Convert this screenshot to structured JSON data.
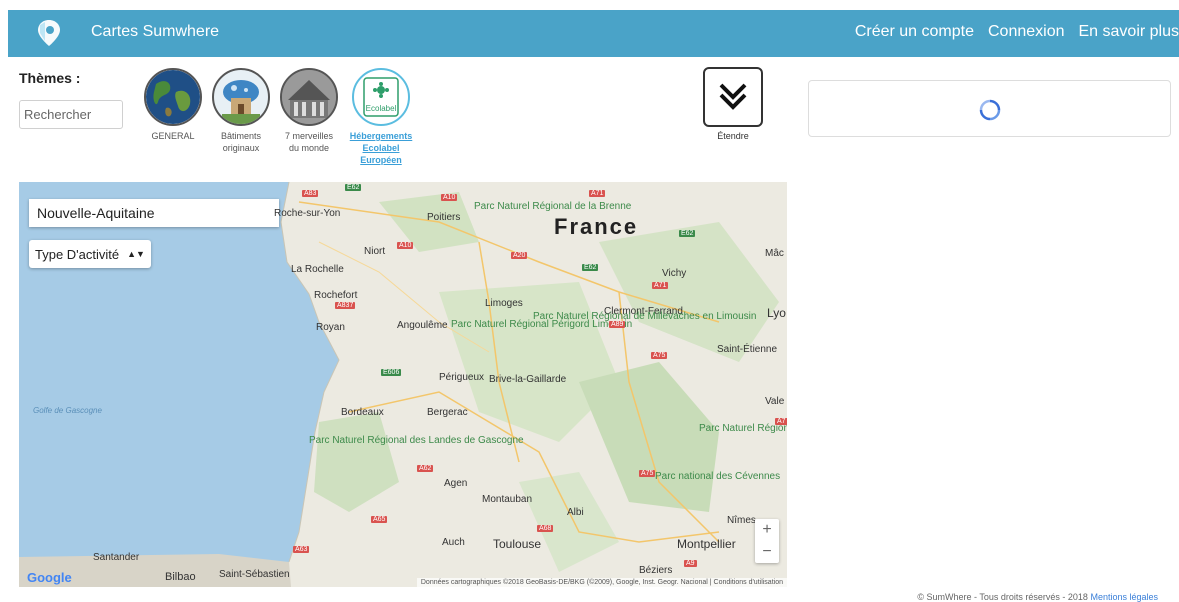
{
  "header": {
    "brand": "Cartes Sumwhere",
    "nav": [
      "Créer un compte",
      "Connexion",
      "En savoir plus"
    ]
  },
  "themes": {
    "label": "Thèmes :",
    "search_placeholder": "Rechercher",
    "items": [
      {
        "line1": "GENERAL",
        "line2": "",
        "line3": ""
      },
      {
        "line1": "Bâtiments",
        "line2": "originaux",
        "line3": ""
      },
      {
        "line1": "7 merveilles",
        "line2": "du monde",
        "line3": ""
      },
      {
        "line1": "Hébergements",
        "line2": "Ecolabel",
        "line3": "Européen"
      }
    ],
    "ecolabel_text": "Ecolabel"
  },
  "extend": {
    "label": "Étendre"
  },
  "map": {
    "region": "Nouvelle-Aquitaine",
    "activity": "Type D'activité",
    "country": "France",
    "cities": [
      "Poitiers",
      "Niort",
      "La Rochelle",
      "Rochefort",
      "Royan",
      "Angoulême",
      "Limoges",
      "Clermont-Ferrand",
      "Vichy",
      "Lyo",
      "Saint-Étienne",
      "Périgueux",
      "Brive-la-Gaillarde",
      "Bordeaux",
      "Bergerac",
      "Agen",
      "Montauban",
      "Albi",
      "Toulouse",
      "Auch",
      "Montpellier",
      "Nîmes",
      "Béziers",
      "Santander",
      "Bilbao",
      "Saint-Sébastien",
      "Vale",
      "Roche-sur-Yon",
      "Mâc"
    ],
    "parks": [
      "Parc Naturel Régional de la Brenne",
      "Parc Naturel Régional Périgord Limousin",
      "Parc Naturel Régional de Millevaches en Limousin",
      "Parc Naturel Régional des Landes de Gascogne",
      "Parc Naturel Régional des Monts d'Ardèche",
      "Parc national des Cévennes"
    ],
    "sea": "Golfe de Gascogne",
    "roads": [
      "A83",
      "E62",
      "A10",
      "A71",
      "A10",
      "A20",
      "E62",
      "E62",
      "A71",
      "A837",
      "A89",
      "A75",
      "E606",
      "A62",
      "A75",
      "A65",
      "A68",
      "A63",
      "A9",
      "A7"
    ],
    "zoom_in": "+",
    "zoom_out": "−",
    "google": "Google",
    "attribution": "Données cartographiques ©2018 GeoBasis-DE/BKG (©2009), Google, Inst. Geogr. Nacional  |  Conditions d'utilisation"
  },
  "footer": {
    "text": "© SumWhere - Tous droits réservés - 2018",
    "link": "Mentions légales"
  },
  "colors": {
    "header": "#4aa3c8",
    "accent": "#3a9fd8"
  }
}
